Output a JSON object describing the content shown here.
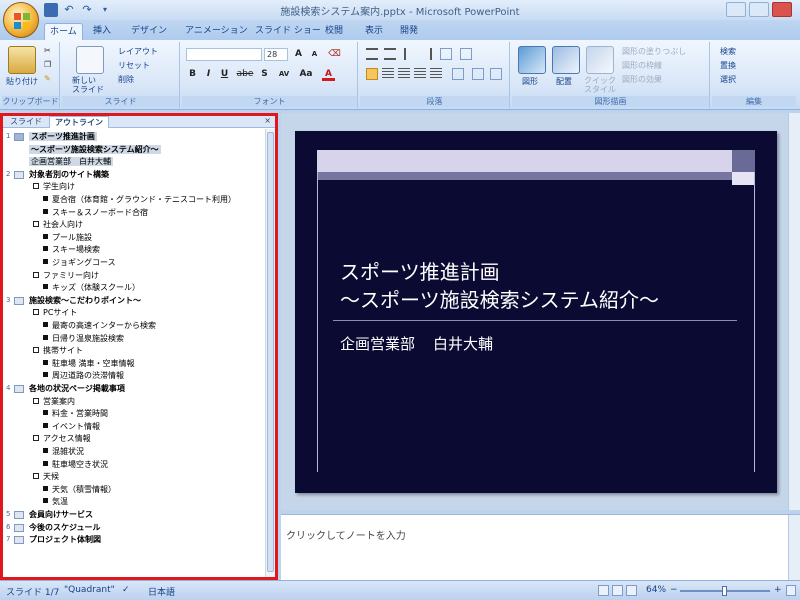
{
  "window": {
    "title": "施設検索システム案内.pptx - Microsoft PowerPoint"
  },
  "ribbon": {
    "tabs": [
      "ホーム",
      "挿入",
      "デザイン",
      "アニメーション",
      "スライド ショー",
      "校閲",
      "表示",
      "開発"
    ],
    "active_tab": "ホーム",
    "groups": {
      "clipboard": {
        "label": "クリップボード",
        "paste": "貼り付け"
      },
      "slides": {
        "label": "スライド",
        "new_slide": "新しい\nスライド",
        "layout": "レイアウト",
        "reset": "リセット",
        "delete": "削除"
      },
      "font": {
        "label": "フォント",
        "size": "28",
        "bold": "B",
        "italic": "I",
        "underline": "U",
        "strike": "abe",
        "shadow": "S",
        "spacing": "AV",
        "case": "Aa",
        "color": "A",
        "grow": "A",
        "shrink": "A"
      },
      "paragraph": {
        "label": "段落"
      },
      "drawing": {
        "label": "図形描画",
        "shapes": "図形",
        "arrange": "配置",
        "quick_styles": "クイック\nスタイル",
        "fill": "図形の塗りつぶし",
        "outline": "図形の枠線",
        "effects": "図形の効果"
      },
      "editing": {
        "label": "編集",
        "find": "検索",
        "replace": "置換",
        "select": "選択"
      }
    }
  },
  "left_panel": {
    "tabs": [
      "スライド",
      "アウトライン"
    ],
    "active_tab": "アウトライン",
    "close": "×"
  },
  "outline": [
    {
      "slide": "1",
      "text": "スポーツ推進計画",
      "kind": "title"
    },
    {
      "slide": "",
      "text": "～スポーツ施設検索システム紹介～",
      "kind": "title-cont"
    },
    {
      "slide": "",
      "text": "企画営業部　白井大輔",
      "kind": "subtitle"
    },
    {
      "slide": "2",
      "text": "対象者別のサイト構築",
      "kind": "title"
    },
    {
      "slide": "",
      "text": "学生向け",
      "kind": "l1"
    },
    {
      "slide": "",
      "text": "夏合宿（体育館・グラウンド・テニスコート利用）",
      "kind": "l2"
    },
    {
      "slide": "",
      "text": "スキー＆スノーボード合宿",
      "kind": "l2"
    },
    {
      "slide": "",
      "text": "社会人向け",
      "kind": "l1"
    },
    {
      "slide": "",
      "text": "プール施設",
      "kind": "l2"
    },
    {
      "slide": "",
      "text": "スキー場検索",
      "kind": "l2"
    },
    {
      "slide": "",
      "text": "ジョギングコース",
      "kind": "l2"
    },
    {
      "slide": "",
      "text": "ファミリー向け",
      "kind": "l1"
    },
    {
      "slide": "",
      "text": "キッズ（体験スクール）",
      "kind": "l2"
    },
    {
      "slide": "3",
      "text": "施設検索～こだわりポイント～",
      "kind": "title"
    },
    {
      "slide": "",
      "text": "PCサイト",
      "kind": "l1"
    },
    {
      "slide": "",
      "text": "最寄の高速インターから検索",
      "kind": "l2"
    },
    {
      "slide": "",
      "text": "日帰り温泉施設検索",
      "kind": "l2"
    },
    {
      "slide": "",
      "text": "携帯サイト",
      "kind": "l1"
    },
    {
      "slide": "",
      "text": "駐車場 満車・空車情報",
      "kind": "l2"
    },
    {
      "slide": "",
      "text": "周辺道路の渋滞情報",
      "kind": "l2"
    },
    {
      "slide": "4",
      "text": "各地の状況ページ掲載事項",
      "kind": "title"
    },
    {
      "slide": "",
      "text": "営業案内",
      "kind": "l1"
    },
    {
      "slide": "",
      "text": "料金・営業時間",
      "kind": "l2"
    },
    {
      "slide": "",
      "text": "イベント情報",
      "kind": "l2"
    },
    {
      "slide": "",
      "text": "アクセス情報",
      "kind": "l1"
    },
    {
      "slide": "",
      "text": "混雑状況",
      "kind": "l2"
    },
    {
      "slide": "",
      "text": "駐車場空き状況",
      "kind": "l2"
    },
    {
      "slide": "",
      "text": "天候",
      "kind": "l1"
    },
    {
      "slide": "",
      "text": "天気（積雪情報）",
      "kind": "l2"
    },
    {
      "slide": "",
      "text": "気温",
      "kind": "l2"
    },
    {
      "slide": "5",
      "text": "会員向けサービス",
      "kind": "title"
    },
    {
      "slide": "6",
      "text": "今後のスケジュール",
      "kind": "title"
    },
    {
      "slide": "7",
      "text": "プロジェクト体制図",
      "kind": "title"
    }
  ],
  "slide": {
    "title_line1": "スポーツ推進計画",
    "title_line2": "～スポーツ施設検索システム紹介～",
    "sub_dept": "企画営業部",
    "sub_name": "白井大輔"
  },
  "notes": {
    "placeholder": "クリックしてノートを入力"
  },
  "status_bar": {
    "slide_info": "スライド 1/7",
    "theme": "\"Quadrant\"",
    "language": "日本語",
    "zoom": "64%"
  }
}
